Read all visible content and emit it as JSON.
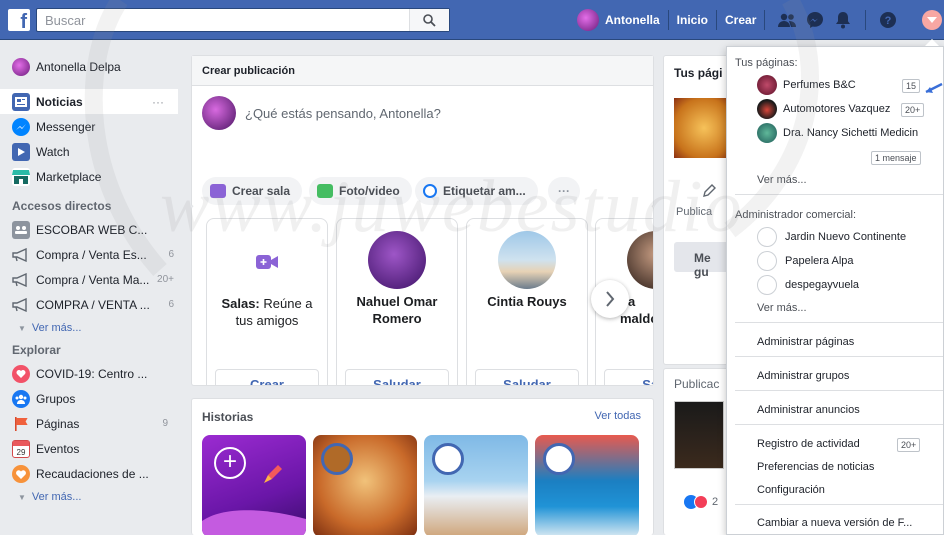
{
  "topbar": {
    "logo": "f",
    "search_placeholder": "Buscar",
    "profile_name": "Antonella",
    "home": "Inicio",
    "create": "Crear"
  },
  "left": {
    "profile": "Antonella Delpa",
    "nav": [
      {
        "label": "Noticias",
        "extra": "···"
      },
      {
        "label": "Messenger"
      },
      {
        "label": "Watch"
      },
      {
        "label": "Marketplace"
      }
    ],
    "shortcuts_title": "Accesos directos",
    "shortcuts": [
      {
        "label": "ESCOBAR WEB C...",
        "count": ""
      },
      {
        "label": "Compra / Venta Es...",
        "count": "6"
      },
      {
        "label": "Compra / Venta Ma...",
        "count": "20+"
      },
      {
        "label": "COMPRA / VENTA ...",
        "count": "6"
      }
    ],
    "see_more_1": "Ver más...",
    "explore_title": "Explorar",
    "explore": [
      {
        "label": "COVID-19: Centro ...",
        "count": ""
      },
      {
        "label": "Grupos",
        "count": ""
      },
      {
        "label": "Páginas",
        "count": "9"
      },
      {
        "label": "Eventos",
        "count": ""
      },
      {
        "label": "Recaudaciones de ...",
        "count": ""
      }
    ],
    "see_more_2": "Ver más..."
  },
  "composer": {
    "header": "Crear publicación",
    "prompt": "¿Qué estás pensando, Antonella?",
    "actions": [
      "Crear sala",
      "Foto/video",
      "Etiquetar am...",
      "···"
    ]
  },
  "people": [
    {
      "name": "Salas:",
      "sub": " Reúne a tus amigos",
      "button": "Crear"
    },
    {
      "name": "Nahuel Omar Romero",
      "button": "Saludar"
    },
    {
      "name": "Cintia Rouys",
      "button": "Saludar"
    },
    {
      "name": "La\nmaldo",
      "button": "Salu"
    }
  ],
  "stories": {
    "title": "Historias",
    "see_all": "Ver todas"
  },
  "right": {
    "pages_title": "Tus pági",
    "publish": "Publica",
    "like": "Me gu",
    "published": "Publicac",
    "reactions": "2"
  },
  "dropdown": {
    "your_pages": "Tus páginas:",
    "pages": [
      {
        "name": "Perfumes B&C",
        "badge": "15"
      },
      {
        "name": "Automotores Vazquez",
        "badge": "20+"
      },
      {
        "name": "Dra. Nancy Sichetti Medicin",
        "badge": ""
      }
    ],
    "message_badge": "1 mensaje",
    "see_more_1": "Ver más...",
    "business_title": "Administrador comercial:",
    "business": [
      "Jardin Nuevo Continente",
      "Papelera Alpa",
      "despegayvuela"
    ],
    "see_more_2": "Ver más...",
    "manage_pages": "Administrar páginas",
    "manage_groups": "Administrar grupos",
    "manage_ads": "Administrar anuncios",
    "activity_log": "Registro de actividad",
    "activity_badge": "20+",
    "news_prefs": "Preferencias de noticias",
    "settings": "Configuración",
    "switch_version": "Cambiar a nueva versión de F..."
  },
  "watermark": "www.juwebestudio",
  "colors": {
    "brand": "#4267b2",
    "link": "#4267b2",
    "bg": "#e9ebee"
  }
}
